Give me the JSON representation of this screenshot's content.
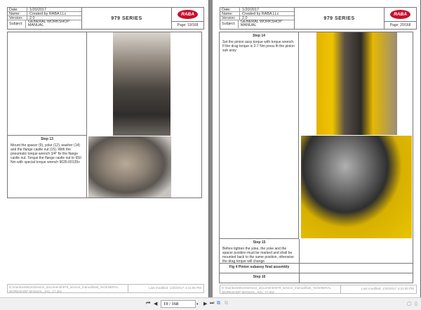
{
  "pages": [
    {
      "header": {
        "date_label": "Date:",
        "date": "1/20/2017",
        "name_label": "Name:",
        "name": "Created by RABA LLc",
        "version_label": "Version:",
        "version": "2.0",
        "subject_label": "Subject:",
        "subject": "GENERAL WORKSHOP MANUAL",
        "series": "979 SERIES",
        "logo": "RABA",
        "page": "Page: 19/168"
      },
      "steps": [
        {
          "title": "Step 13",
          "text": "Mount the spacer (9), yoke (12), washer (14) and the flange castle nut (15). With the pneumatic torque wrench 3/4\" fix the flange castle nut. Torque the flange castle nut to 650 Nm with special torque wrench 9635-00139+"
        }
      ],
      "footer": {
        "path": "D:\\munka\\45616\\Service_documents\\979_service_manual\\last_%GENERAL WORKSHOP MANUAL_XXL_17.doc",
        "modified": "Last modified: 1/20/2017 4:31:00 PM"
      }
    },
    {
      "header": {
        "date_label": "Date:",
        "date": "1/20/2017",
        "name_label": "Name:",
        "name": "Created by RABA LLc",
        "version_label": "Version:",
        "version": "2.0",
        "subject_label": "Subject:",
        "subject": "GENERAL WORKSHOP MANUAL",
        "series": "979 SERIES",
        "logo": "RABA",
        "page": "Page: 20/168"
      },
      "steps": [
        {
          "title": "Step 14",
          "text": "Set the pinion assy torque with torque wrench. If the drag torque is 2-7 Nm press fit the pinion sub assy"
        },
        {
          "title": "Step 15",
          "text": "Before tighten the yoke, the yoke and the spacer position must be marked and shall be mounted back to the same position, otherwise the drag torque will change"
        },
        {
          "title": "Fig 4 Pinion subassy final assembly",
          "text": ""
        },
        {
          "title": "Step 16",
          "text": ""
        }
      ],
      "footer": {
        "path": "D:\\munka\\45616\\Service_documents\\979_service_manual\\last_%GENERAL WORKSHOP MANUAL_XXL_17.doc",
        "modified": "Last modified: 1/20/2017 4:31:00 PM"
      }
    }
  ],
  "toolbar": {
    "page_value": "19 / 168"
  }
}
